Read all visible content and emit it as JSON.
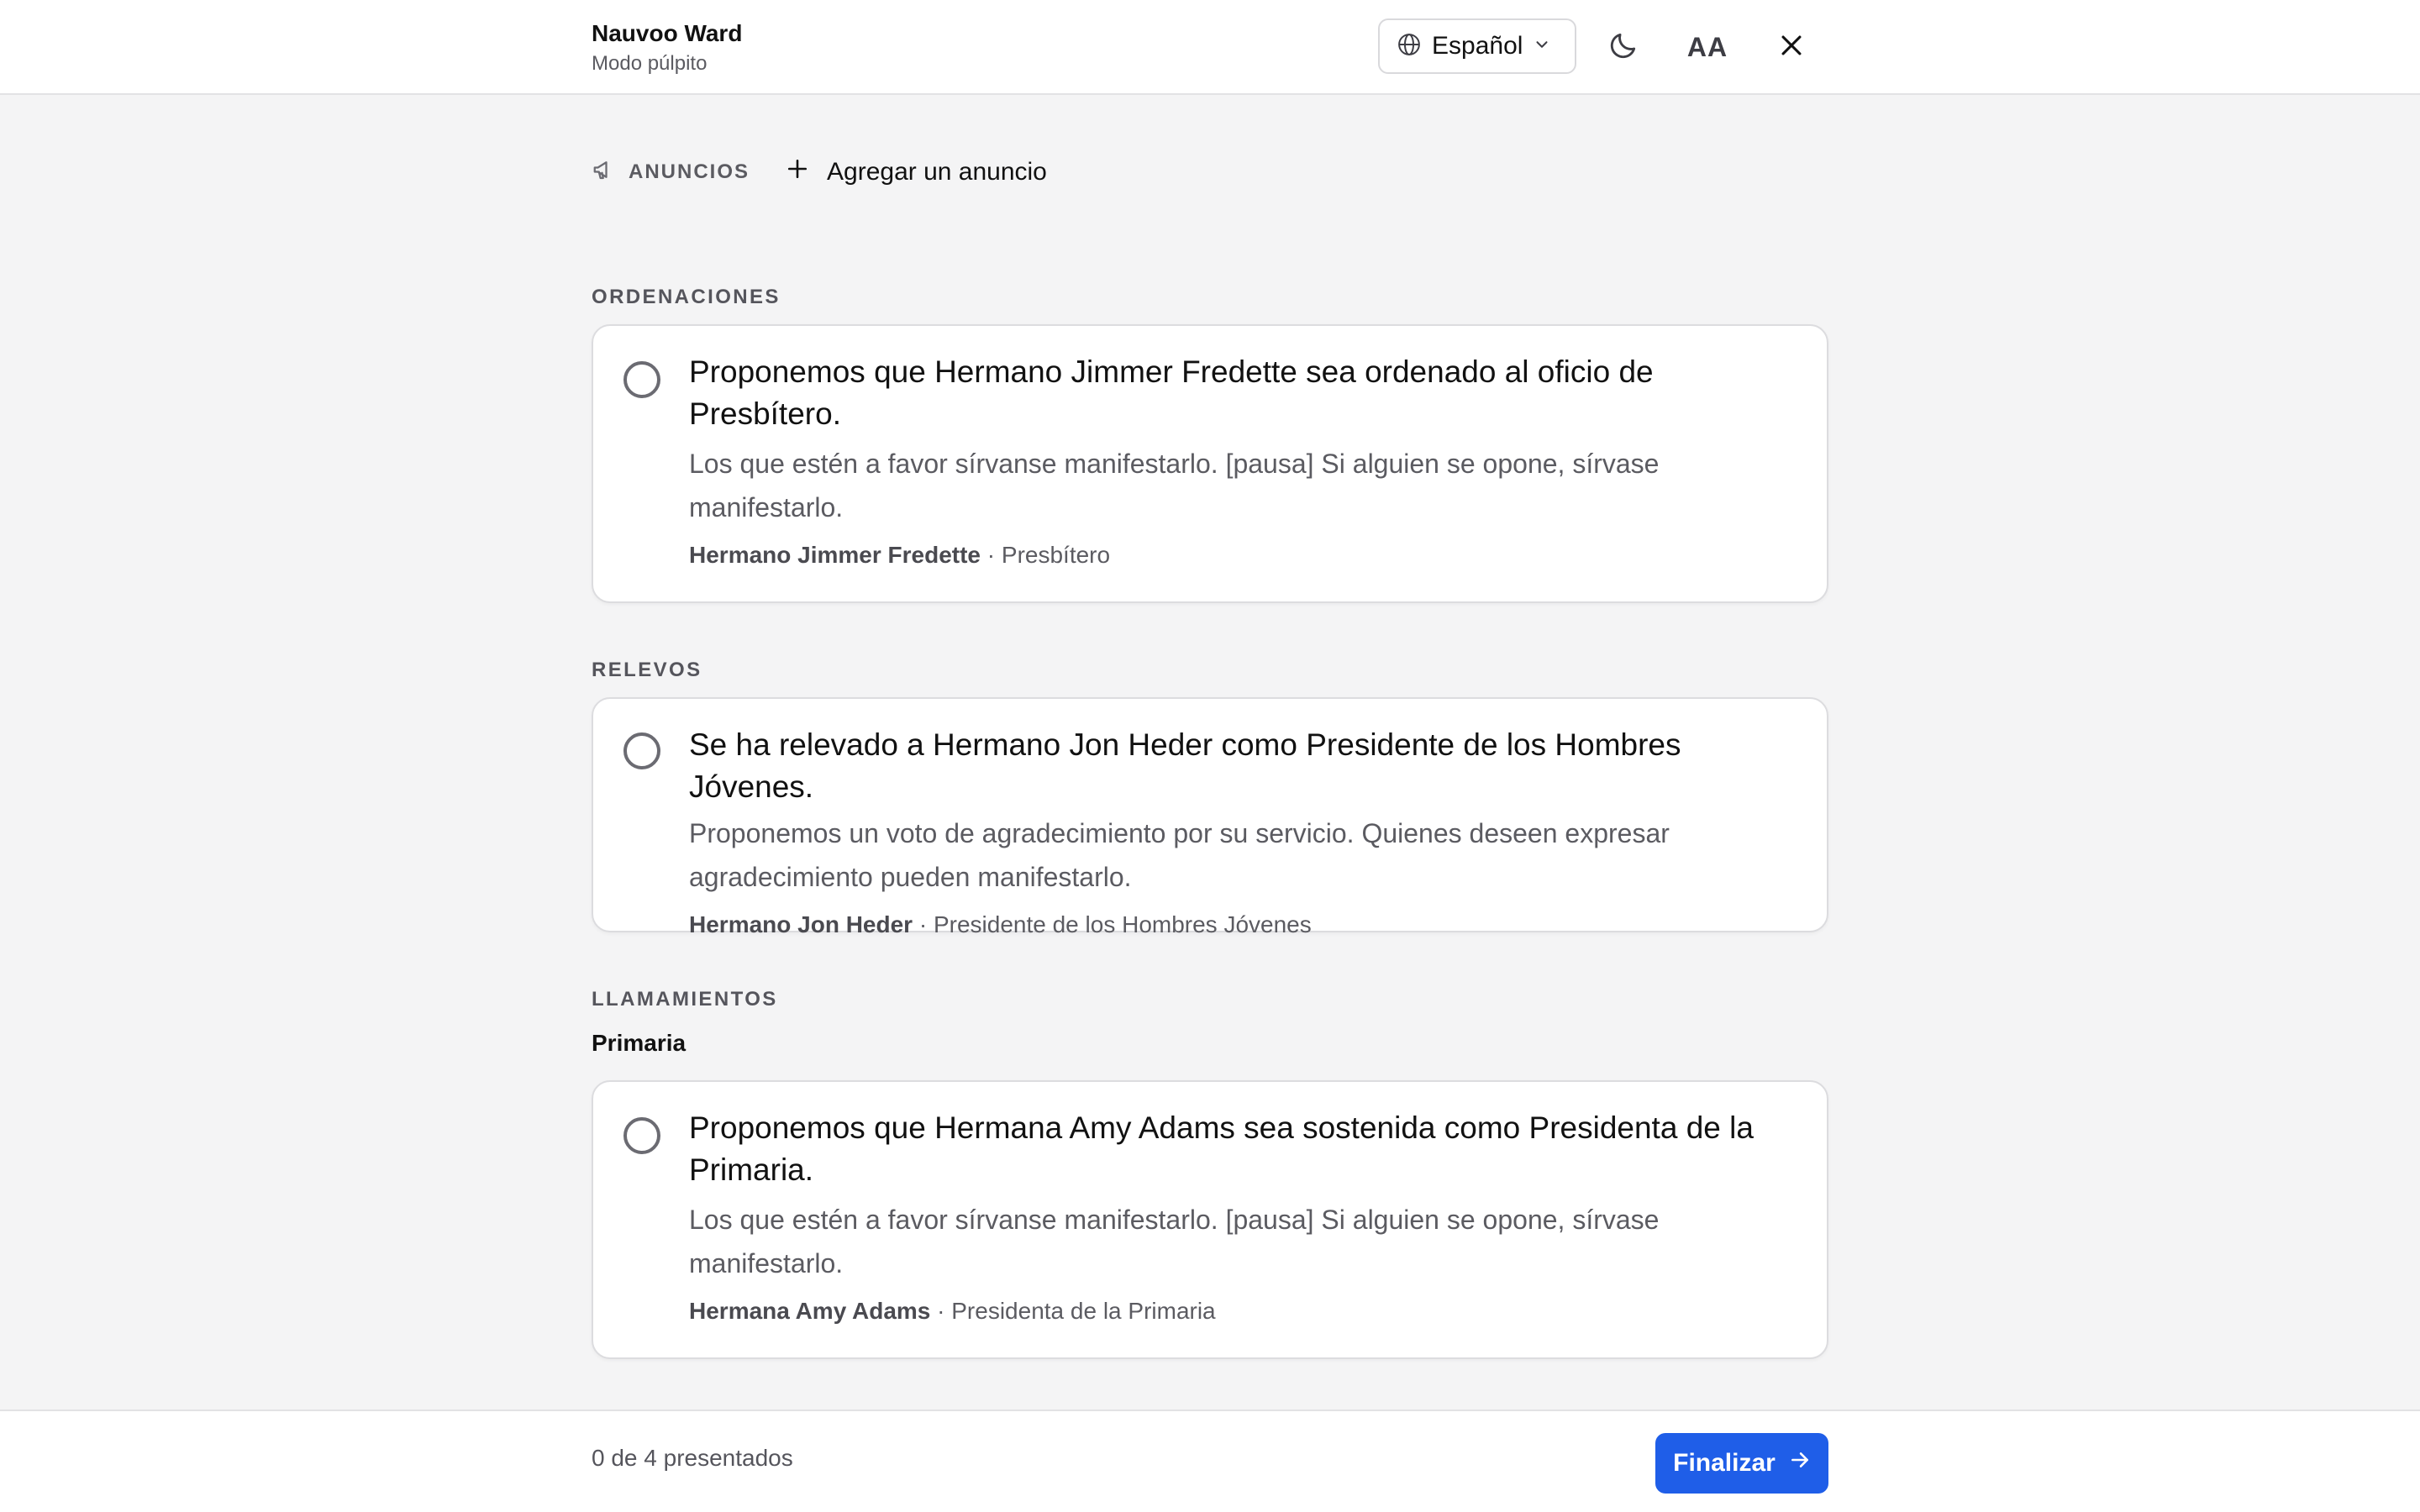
{
  "header": {
    "ward_name": "Nauvoo Ward",
    "mode": "Modo púlpito",
    "language": "Español",
    "icons": [
      "globe-icon",
      "chevron-down-icon",
      "moon-icon",
      "text-size-icon",
      "close-icon"
    ],
    "text_size_label": "AA"
  },
  "announcements": {
    "label": "ANUNCIOS",
    "add_label": "Agregar un anuncio"
  },
  "sections": {
    "ordinations": {
      "label": "ORDENACIONES",
      "items": [
        {
          "headline": "Proponemos que Hermano Jimmer Fredette sea ordenado al oficio de Presbítero.",
          "description": "Los que estén a favor sírvanse manifestarlo. [pausa] Si alguien se opone, sírvase manifestarlo.",
          "person": "Hermano Jimmer Fredette",
          "role": "· Presbítero"
        }
      ]
    },
    "releases": {
      "label": "RELEVOS",
      "items": [
        {
          "headline": "Se ha relevado a Hermano Jon Heder como Presidente de los Hombres Jóvenes.",
          "description": "Proponemos un voto de agradecimiento por su servicio. Quienes deseen expresar agradecimiento pueden manifestarlo.",
          "person": "Hermano Jon Heder",
          "role": "· Presidente de los Hombres Jóvenes"
        }
      ]
    },
    "callings": {
      "label": "LLAMAMIENTOS",
      "groups": [
        {
          "name": "Primaria",
          "items": [
            {
              "headline": "Proponemos que Hermana Amy Adams sea sostenida como Presidenta de la Primaria.",
              "description": "Los que estén a favor sírvanse manifestarlo. [pausa] Si alguien se opone, sírvase manifestarlo.",
              "person": "Hermana Amy Adams",
              "role": "· Presidenta de la Primaria"
            }
          ]
        }
      ]
    }
  },
  "footer": {
    "progress_text": "0 de 4 presentados",
    "presented": 0,
    "total": 4,
    "finish_label": "Finalizar"
  },
  "colors": {
    "accent": "#1f5ee8",
    "background": "#f4f4f5",
    "card": "#ffffff",
    "muted_text": "#5b5b61"
  }
}
